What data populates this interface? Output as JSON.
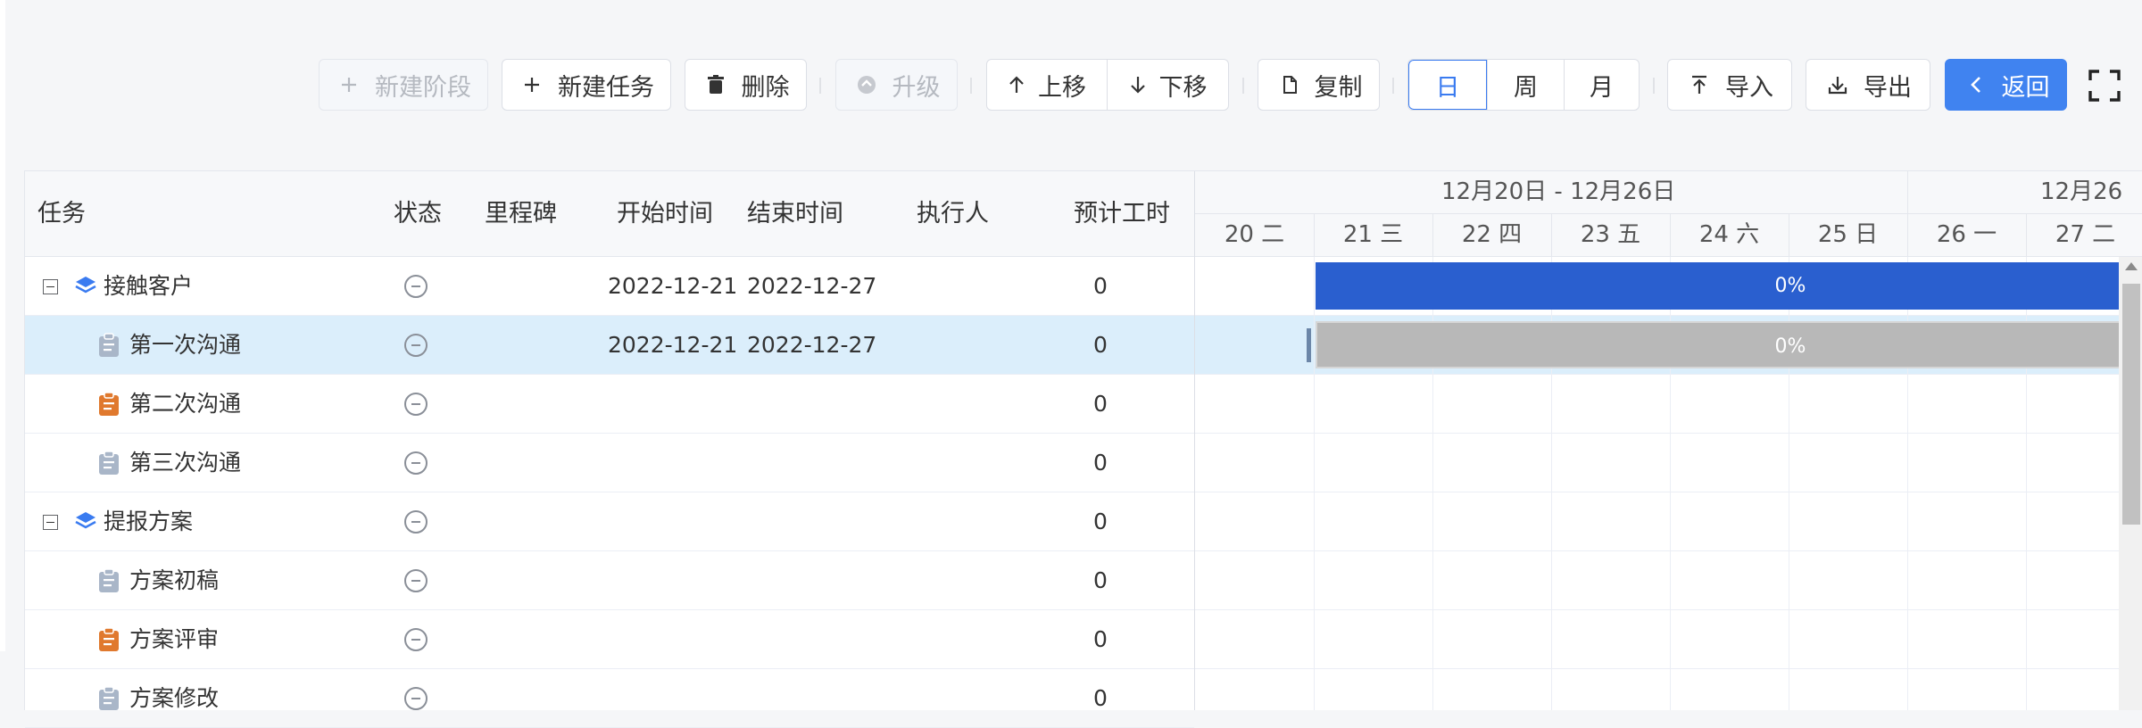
{
  "toolbar": {
    "new_stage": "新建阶段",
    "new_task": "新建任务",
    "delete": "删除",
    "upgrade": "升级",
    "move_up": "上移",
    "move_down": "下移",
    "copy": "复制",
    "view_day": "日",
    "view_week": "周",
    "view_month": "月",
    "active_view": "日",
    "import": "导入",
    "export": "导出",
    "back": "返回"
  },
  "table": {
    "headers": {
      "task": "任务",
      "status": "状态",
      "milestone": "里程碑",
      "start": "开始时间",
      "end": "结束时间",
      "assignee": "执行人",
      "estimate": "预计工时"
    },
    "rows": [
      {
        "name": "接触客户",
        "type": "stage",
        "start": "2022-12-21",
        "end": "2022-12-27",
        "estimate": "0"
      },
      {
        "name": "第一次沟通",
        "type": "task",
        "icon_color": "#a9b6c8",
        "start": "2022-12-21",
        "end": "2022-12-27",
        "estimate": "0",
        "selected": true
      },
      {
        "name": "第二次沟通",
        "type": "task",
        "icon_color": "#e0792e",
        "start": "",
        "end": "",
        "estimate": "0"
      },
      {
        "name": "第三次沟通",
        "type": "task",
        "icon_color": "#a9b6c8",
        "start": "",
        "end": "",
        "estimate": "0"
      },
      {
        "name": "提报方案",
        "type": "stage",
        "start": "",
        "end": "",
        "estimate": "0"
      },
      {
        "name": "方案初稿",
        "type": "task",
        "icon_color": "#a9b6c8",
        "start": "",
        "end": "",
        "estimate": "0"
      },
      {
        "name": "方案评审",
        "type": "task",
        "icon_color": "#e0792e",
        "start": "",
        "end": "",
        "estimate": "0"
      },
      {
        "name": "方案修改",
        "type": "task",
        "icon_color": "#a9b6c8",
        "start": "",
        "end": "",
        "estimate": "0"
      }
    ]
  },
  "gantt": {
    "week_range": "12月20日 - 12月26日",
    "next_range": "12月26",
    "days": [
      "20 二",
      "21 三",
      "22 四",
      "23 五",
      "24 六",
      "25 日",
      "26 一",
      "27 二"
    ],
    "bars": [
      {
        "row": 0,
        "label": "0%",
        "progress": 0,
        "color": "#2a5fcf"
      },
      {
        "row": 1,
        "label": "0%",
        "progress": 0,
        "color": "#b8b8b8"
      }
    ]
  },
  "colors": {
    "primary": "#4083f0",
    "selected_row": "#dbeefb",
    "stage_icon": "#3a7bf0"
  }
}
